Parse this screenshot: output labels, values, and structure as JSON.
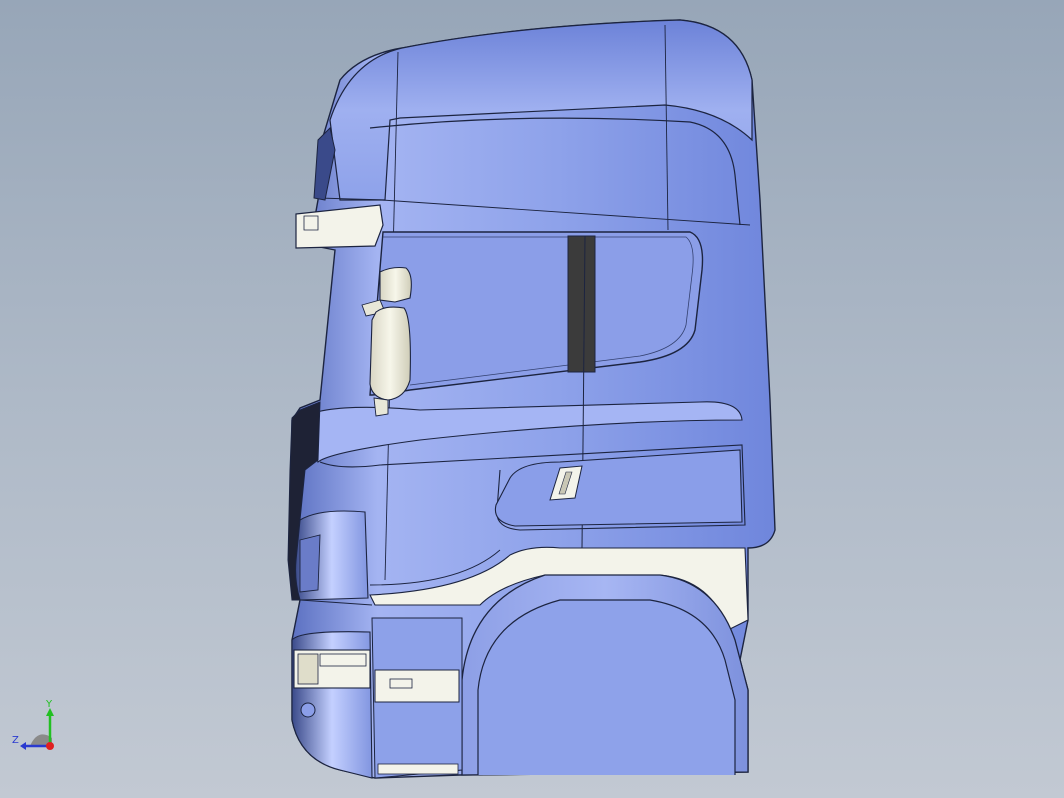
{
  "viewport": {
    "model_name": "",
    "background_top": "#97a6b8",
    "background_bottom": "#c2c9d3",
    "body_color": "#7f95e2",
    "edge_color": "#1c2440",
    "accent_white": "#f3f3ea",
    "dark_panel": "#3b3b3b"
  },
  "triad": {
    "y_label": "Y",
    "z_label": "Z",
    "y_color": "#22c022",
    "z_color": "#2a3ad0",
    "x_color": "#e02020"
  }
}
